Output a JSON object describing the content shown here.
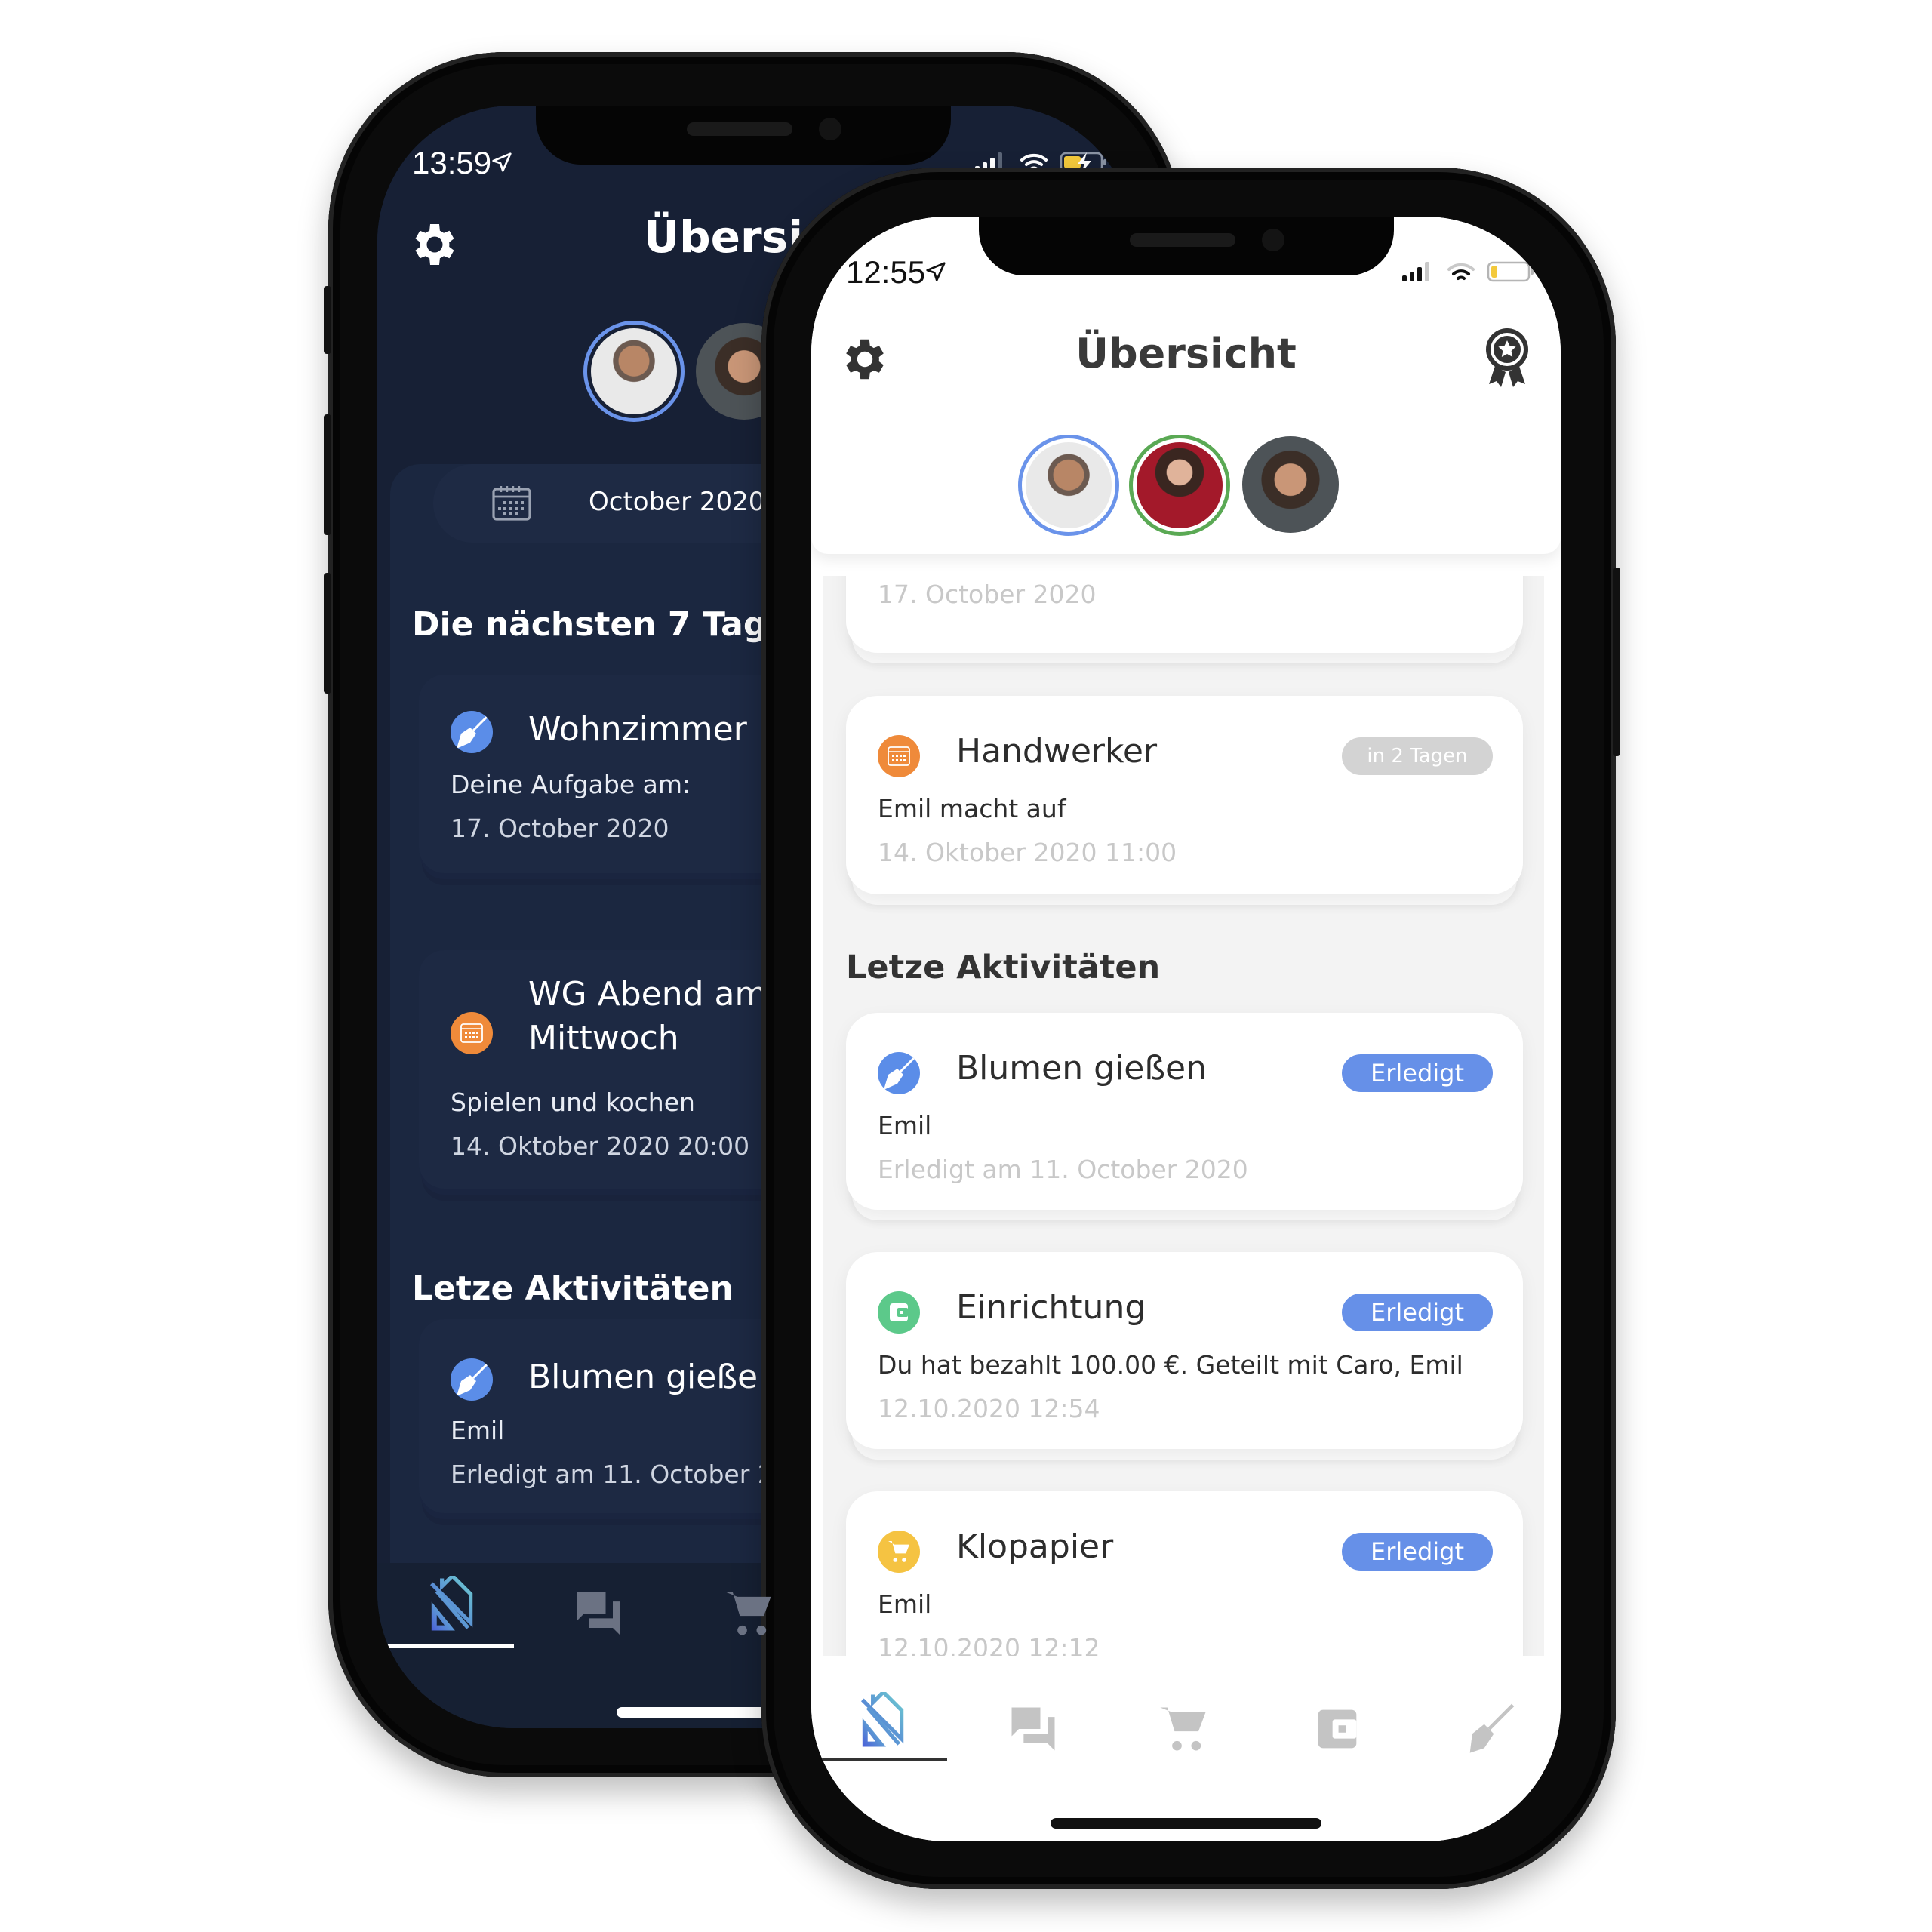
{
  "dark_phone": {
    "status_time": "13:59",
    "title": "Übersicht",
    "month_selector": "October 2020",
    "section_upcoming": "Die nächsten 7 Tage",
    "upcoming": [
      {
        "icon": "broom-icon",
        "icon_color": "#5b8de8",
        "title": "Wohnzimmer",
        "line1": "Deine Aufgabe am:",
        "line2": "17. October 2020"
      },
      {
        "icon": "calendar-icon",
        "icon_color": "#ef8a3a",
        "title": "WG Abend am Mittwoch",
        "line1": "Spielen und kochen",
        "line2": "14. Oktober 2020 20:00"
      }
    ],
    "section_recent": "Letze Aktivitäten",
    "recent": [
      {
        "icon": "broom-icon",
        "icon_color": "#5b8de8",
        "title": "Blumen gießen",
        "line1": "Emil",
        "line2": "Erledigt am 11. October 2020"
      }
    ],
    "tabs": [
      "home",
      "chat",
      "cart"
    ],
    "active_tab": "home"
  },
  "light_phone": {
    "status_time": "12:55",
    "title": "Übersicht",
    "partial_card_date": "17. October 2020",
    "upcoming": [
      {
        "icon": "calendar-icon",
        "icon_color": "#ef8a3a",
        "title": "Handwerker",
        "badge": "in 2 Tagen",
        "line1": "Emil macht auf",
        "line2": "14. Oktober 2020 11:00"
      }
    ],
    "section_recent": "Letze Aktivitäten",
    "recent": [
      {
        "icon": "broom-icon",
        "icon_color": "#5b8de8",
        "title": "Blumen gießen",
        "badge": "Erledigt",
        "line1": "Emil",
        "line2": "Erledigt am 11. October 2020"
      },
      {
        "icon": "wallet-icon",
        "icon_color": "#5cc98a",
        "title": "Einrichtung",
        "badge": "Erledigt",
        "line1": "Du hat bezahlt 100.00 €. Geteilt mit Caro, Emil",
        "line2": "12.10.2020 12:54"
      },
      {
        "icon": "cart-icon",
        "icon_color": "#f5c342",
        "title": "Klopapier",
        "badge": "Erledigt",
        "line1": "Emil",
        "line2": "12.10.2020 12:12"
      }
    ],
    "tabs": [
      "home",
      "chat",
      "cart",
      "wallet",
      "broom"
    ],
    "active_tab": "home"
  },
  "colors": {
    "accent_blue": "#6690e8",
    "badge_grey": "#d3d3d3",
    "dark_bg": "#172035",
    "ring_blue": "#6a93ea",
    "ring_green": "#5aa954"
  }
}
